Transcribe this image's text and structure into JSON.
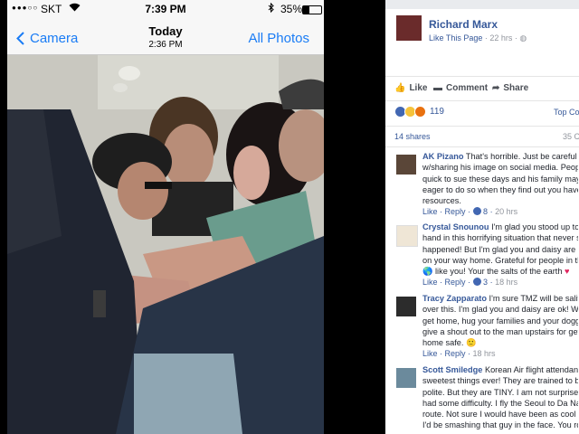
{
  "phone": {
    "status": {
      "carrier": "SKT",
      "time": "7:39 PM",
      "battery": "35%",
      "battery_level": 0.35
    },
    "nav": {
      "back_label": "Camera",
      "date": "Today",
      "time": "2:36 PM",
      "all_photos": "All Photos"
    }
  },
  "post": {
    "author": "Richard Marx",
    "like_page": "Like This Page",
    "time_ago": "22 hrs",
    "actions": {
      "like": "Like",
      "comment": "Comment",
      "share": "Share"
    },
    "reaction_count": "119",
    "top_comments": "Top Co",
    "shares": "14 shares",
    "comment_count": "35 C"
  },
  "comments": [
    {
      "author": "AK Pizano",
      "lines": [
        "That's horrible. Just be careful",
        "w/sharing his image on social media. People",
        "quick to sue these days and his family may b",
        "eager to do so when they find out you have t",
        "resources."
      ],
      "like": "Like",
      "reply": "Reply",
      "likes": "8",
      "time": "20 hrs"
    },
    {
      "author": "Crystal Snounou",
      "lines": [
        "I'm glad you stood up to l",
        "hand in this horrifying situation that never sh",
        "happened! But I'm glad you and daisy are sa",
        "on your way home. Grateful for people in the",
        "like you! Your the salts of the earth"
      ],
      "like": "Like",
      "reply": "Reply",
      "likes": "3",
      "time": "18 hrs"
    },
    {
      "author": "Tracy Zapparato",
      "lines": [
        "I'm sure TMZ will be saliva",
        "over this. I'm glad you and daisy are ok! Whe",
        "get home, hug your families and your doggie",
        "give a shout out to the man upstairs for gettin",
        "home safe."
      ],
      "like": "Like",
      "reply": "Reply",
      "time": "18 hrs"
    },
    {
      "author": "Scott Smiledge",
      "lines": [
        "Korean Air flight attendants",
        "sweetest things ever! They are trained to be",
        "polite. But they are TINY. I am not surprised",
        "had some difficulty. I fly the Seoul to Da Nan",
        "route. Not sure I would have been as cool he",
        "I'd be smashing that guy in the face. You roc"
      ]
    }
  ]
}
